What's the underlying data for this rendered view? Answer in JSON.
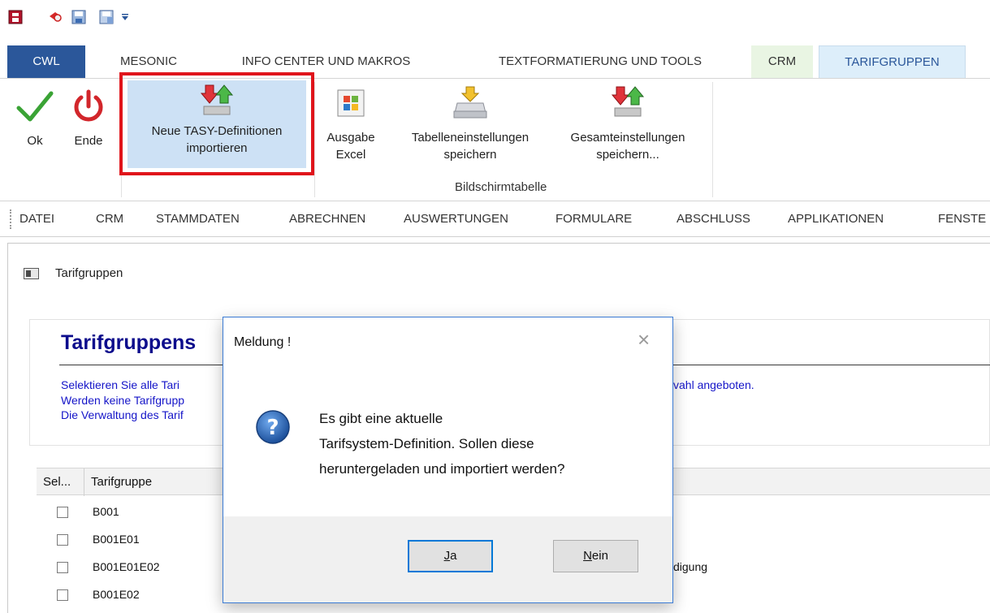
{
  "ribbon_tabs": [
    "CWL",
    "MESONIC",
    "INFO CENTER UND MAKROS",
    "TEXTFORMATIERUNG UND TOOLS",
    "CRM",
    "TARIFGRUPPEN"
  ],
  "ribbon": {
    "ok": "Ok",
    "ende": "Ende",
    "import_line1": "Neue TASY-Definitionen",
    "import_line2": "importieren",
    "excel_line1": "Ausgabe",
    "excel_line2": "Excel",
    "table_line1": "Tabelleneinstellungen",
    "table_line2": "speichern",
    "total_line1": "Gesamteinstellungen",
    "total_line2": "speichern...",
    "group_label": "Bildschirmtabelle"
  },
  "menu": [
    "DATEI",
    "CRM",
    "STAMMDATEN",
    "ABRECHNEN",
    "AUSWERTUNGEN",
    "FORMULARE",
    "ABSCHLUSS",
    "APPLIKATIONEN",
    "FENSTE"
  ],
  "window": {
    "title": "Tarifgruppen",
    "heading": "Tarifgruppens",
    "info1": "Selektieren Sie alle Tari",
    "info1_tail": "vahl angeboten.",
    "info2": "Werden keine Tarifgrupp",
    "info3": "Die Verwaltung des Tarif"
  },
  "grid": {
    "col_sel": "Sel...",
    "col_tarif": "Tarifgruppe",
    "rows": [
      {
        "code": "B001",
        "extra": ""
      },
      {
        "code": "B001E01",
        "extra": ""
      },
      {
        "code": "B001E01E02",
        "extra": "digung"
      },
      {
        "code": "B001E02",
        "extra": ""
      }
    ]
  },
  "dialog": {
    "title": "Meldung !",
    "close": "×",
    "line1": "Es gibt eine aktuelle",
    "line2": "Tarifsystem-Definition. Sollen diese",
    "line3": "heruntergeladen und importiert werden?",
    "yes_mnemonic": "J",
    "yes_rest": "a",
    "no_mnemonic": "N",
    "no_rest": "ein"
  },
  "colors": {
    "accent": "#2b579a",
    "highlight_border": "#e0141b",
    "info_text": "#1414c8",
    "heading_text": "#0c0c8c"
  }
}
